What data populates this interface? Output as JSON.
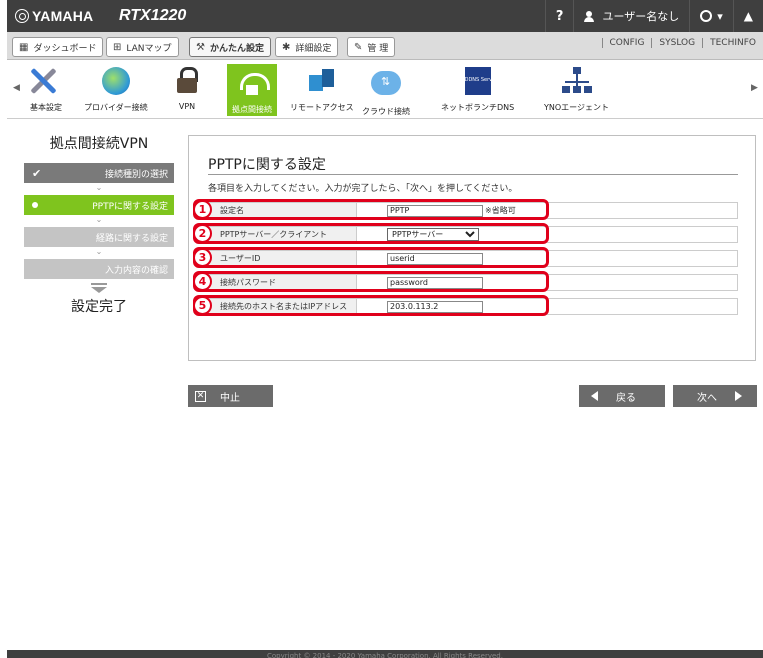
{
  "header": {
    "brand": "YAMAHA",
    "model": "RTX1220",
    "help": "?",
    "user": "ユーザー名なし"
  },
  "tabs": [
    {
      "label": "ダッシュボード"
    },
    {
      "label": "LANマップ"
    },
    {
      "label": "かんたん設定"
    },
    {
      "label": "詳細設定"
    },
    {
      "label": "管 理"
    }
  ],
  "top_links": [
    "CONFIG",
    "SYSLOG",
    "TECHINFO"
  ],
  "iconbar": [
    {
      "label": "基本設定",
      "icon": "wrench-icon"
    },
    {
      "label": "プロバイダー接続",
      "icon": "globe-icon"
    },
    {
      "label": "VPN",
      "icon": "lock-icon"
    },
    {
      "label": "拠点間接続",
      "icon": "site-link-icon"
    },
    {
      "label": "リモートアクセス",
      "icon": "remote-access-icon"
    },
    {
      "label": "クラウド接続",
      "icon": "cloud-icon"
    },
    {
      "label": "ネットボランチDNS",
      "icon": "ddns-icon"
    },
    {
      "label": "YNOエージェント",
      "icon": "network-icon"
    }
  ],
  "ddns_badge": "DDNS Service",
  "sidebar": {
    "title": "拠点間接続VPN",
    "steps": [
      {
        "label": "接続種別の選択",
        "state": "done"
      },
      {
        "label": "PPTPに関する設定",
        "state": "current"
      },
      {
        "label": "経路に関する設定",
        "state": "todo"
      },
      {
        "label": "入力内容の確認",
        "state": "todo"
      }
    ],
    "finish": "設定完了"
  },
  "panel": {
    "title": "PPTPに関する設定",
    "description": "各項目を入力してください。入力が完了したら、「次へ」を押してください。",
    "fields": [
      {
        "num": "1",
        "label": "設定名",
        "value": "PPTP",
        "note": "※省略可"
      },
      {
        "num": "2",
        "label": "PPTPサーバー／クライアント",
        "value": "PPTPサーバー"
      },
      {
        "num": "3",
        "label": "ユーザーID",
        "value": "userid"
      },
      {
        "num": "4",
        "label": "接続パスワード",
        "value": "password"
      },
      {
        "num": "5",
        "label": "接続先のホスト名またはIPアドレス",
        "value": "203.0.113.2"
      }
    ]
  },
  "buttons": {
    "cancel": "中止",
    "back": "戻る",
    "next": "次へ"
  },
  "footer": "Copyright © 2014 - 2020 Yamaha Corporation. All Rights Reserved.",
  "colors": {
    "accent_green": "#7fc41e",
    "annotation_red": "#e0001b",
    "header_dark": "#3f3f3f"
  }
}
